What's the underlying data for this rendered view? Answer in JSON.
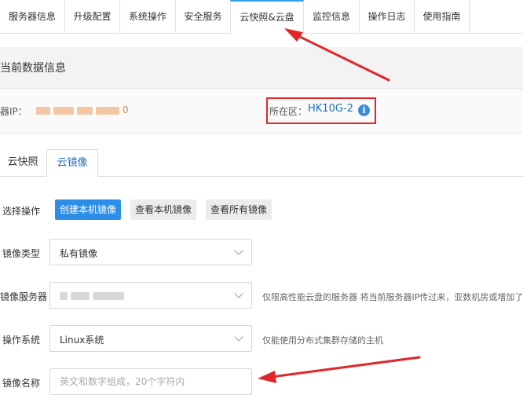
{
  "nav": {
    "tabs": [
      {
        "label": "服务器信息"
      },
      {
        "label": "升级配置"
      },
      {
        "label": "系统操作"
      },
      {
        "label": "安全服务"
      },
      {
        "label": "云快照&云盘"
      },
      {
        "label": "监控信息"
      },
      {
        "label": "操作日志"
      },
      {
        "label": "使用指南"
      }
    ],
    "active_index": 4
  },
  "section": {
    "title": "当前数据信息",
    "ip_label": "器IP：",
    "ip_value_suffix": "0",
    "region_label": "所在区：",
    "region_value": "HK10G-2"
  },
  "subtabs": [
    {
      "label": "云快照"
    },
    {
      "label": "云镜像"
    }
  ],
  "form": {
    "op_label": "选择操作",
    "buttons": [
      {
        "label": "创建本机镜像"
      },
      {
        "label": "查看本机镜像"
      },
      {
        "label": "查看所有镜像"
      }
    ],
    "image_type_label": "镜像类型",
    "image_type_value": "私有镜像",
    "image_server_label": "镜像服务器",
    "image_server_hint": "仅限高性能云盘的服务器 将当前服务器IP传过来，亚数机房或增加了独立",
    "os_label": "操作系统",
    "os_value": "Linux系统",
    "os_hint": "仅能使用分布式集群存储的主机",
    "image_name_label": "镜像名称",
    "image_name_placeholder": "英文和数字组成，20个字符内"
  },
  "colors": {
    "accent": "#2d8ee8",
    "annotation": "#e2262b"
  }
}
